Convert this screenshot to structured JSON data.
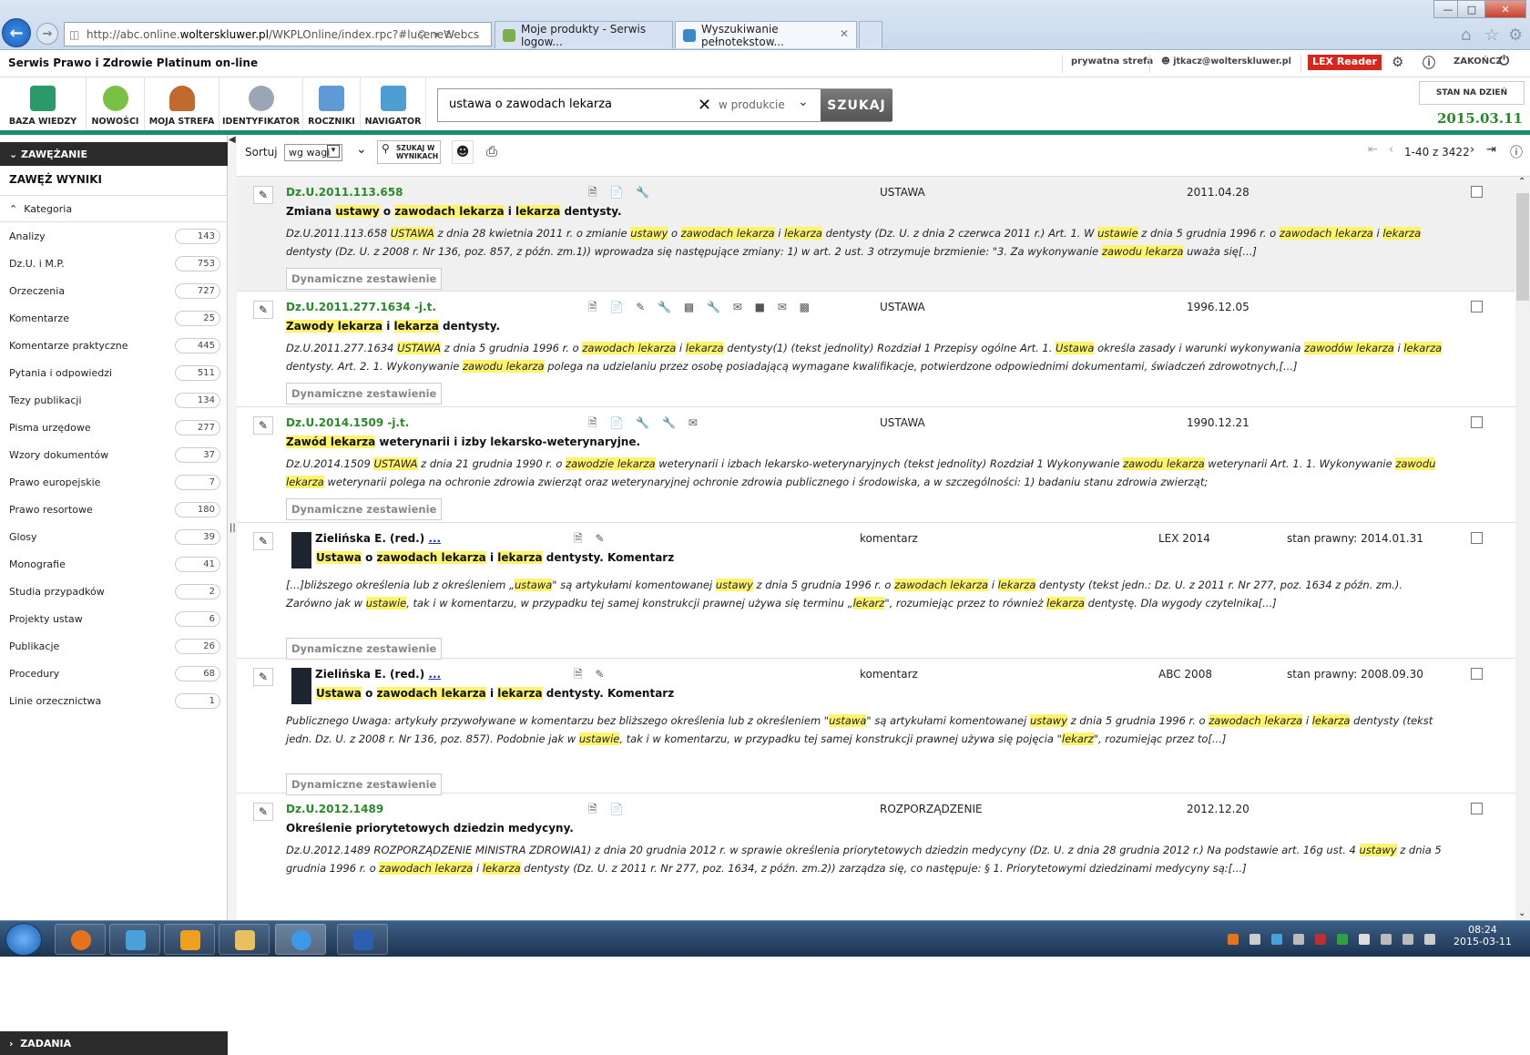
{
  "browser": {
    "url_prefix": "http://abc.online.",
    "url_domain": "wolterskluwer.pl",
    "url_rest": "/WKPLOnline/index.rpc?#luceneWebcs",
    "tabs": [
      {
        "label": "Moje produkty - Serwis logow..."
      },
      {
        "label": "Wyszukiwanie pełnotekstow..."
      }
    ]
  },
  "header": {
    "brand": "Serwis Prawo i Zdrowie Platinum on-line",
    "private": "prywatna strefa",
    "user": "jtkacz@wolterskluwer.pl",
    "lex_reader": "LEX Reader",
    "logout": "ZAKOŃCZ",
    "stan_label": "STAN NA DZIEŃ",
    "date": "2015.03.11"
  },
  "nav": [
    {
      "label": "BAZA WIEDZY",
      "icon": "knowledge-base-icon",
      "color": "#2a9a6a"
    },
    {
      "label": "NOWOŚCI",
      "icon": "news-icon",
      "color": "#7ac043"
    },
    {
      "label": "MOJA STREFA",
      "icon": "user-icon",
      "color": "#c06a30"
    },
    {
      "label": "IDENTYFIKATOR",
      "icon": "magnifier-icon",
      "color": "#9aa6b4"
    },
    {
      "label": "ROCZNIKI",
      "icon": "books-icon",
      "color": "#5f9ad6"
    },
    {
      "label": "NAVIGATOR",
      "icon": "navigator-icon",
      "color": "#4c9fd0"
    }
  ],
  "search": {
    "value": "ustawa o zawodach lekarza",
    "scope": "w produkcie",
    "button": "SZUKAJ"
  },
  "sidebar": {
    "zawezanie": "ZAWĘŻANIE",
    "zawez": "ZAWĘŻ WYNIKI",
    "kategoria": "Kategoria",
    "zadania": "ZADANIA",
    "items": [
      {
        "label": "Analizy",
        "count": "143"
      },
      {
        "label": "Dz.U. i M.P.",
        "count": "753"
      },
      {
        "label": "Orzeczenia",
        "count": "727"
      },
      {
        "label": "Komentarze",
        "count": "25"
      },
      {
        "label": "Komentarze praktyczne",
        "count": "445"
      },
      {
        "label": "Pytania i odpowiedzi",
        "count": "511"
      },
      {
        "label": "Tezy publikacji",
        "count": "134"
      },
      {
        "label": "Pisma urzędowe",
        "count": "277"
      },
      {
        "label": "Wzory dokumentów",
        "count": "37"
      },
      {
        "label": "Prawo europejskie",
        "count": "7"
      },
      {
        "label": "Prawo resortowe",
        "count": "180"
      },
      {
        "label": "Glosy",
        "count": "39"
      },
      {
        "label": "Monografie",
        "count": "41"
      },
      {
        "label": "Studia przypadków",
        "count": "2"
      },
      {
        "label": "Projekty ustaw",
        "count": "6"
      },
      {
        "label": "Publikacje",
        "count": "26"
      },
      {
        "label": "Procedury",
        "count": "68"
      },
      {
        "label": "Linie orzecznictwa",
        "count": "1"
      }
    ]
  },
  "toolbar": {
    "sort": "Sortuj",
    "sort_value": "wg wagi",
    "search_in": "SZUKAJ W WYNIKACH",
    "pager": "1-40 z 3422"
  },
  "dyn_label": "Dynamiczne zestawienie",
  "results": [
    {
      "sig": "Dz.U.2011.113.658",
      "type": "USTAWA",
      "date": "2011.04.28",
      "title": "Zmiana <span class='hl'>ustawy</span> o <span class='hl'>zawodach lekarza</span> i <span class='hl'>lekarza</span> dentysty.",
      "snippet": "Dz.U.2011.113.658 <span class='hl'>USTAWA</span> z dnia 28 kwietnia 2011 r. o zmianie <span class='hl'>ustawy</span> o <span class='hl'>zawodach lekarza</span> i <span class='hl'>lekarza</span> dentysty (Dz. U. z dnia 2 czerwca 2011 r.) Art. 1. W <span class='hl'>ustawie</span> z dnia 5 grudnia 1996 r. o <span class='hl'>zawodach lekarza</span> i <span class='hl'>lekarza</span> dentysty (Dz. U. z 2008 r. Nr 136, poz. 857, z późn. zm.1)) wprowadza się następujące zmiany: 1) w art. 2 ust. 3 otrzymuje brzmienie: \"3. Za wykonywanie <span class='hl'>zawodu lekarza</span> uważa się[...]"
    },
    {
      "sig": "Dz.U.2011.277.1634 -j.t.",
      "type": "USTAWA",
      "date": "1996.12.05",
      "title": "<span class='hl'>Zawody lekarza</span> i <span class='hl'>lekarza</span> dentysty.",
      "snippet": "Dz.U.2011.277.1634 <span class='hl'>USTAWA</span> z dnia 5 grudnia 1996 r. o <span class='hl'>zawodach lekarza</span> i <span class='hl'>lekarza</span> dentysty(1) (tekst jednolity) Rozdział 1 Przepisy ogólne Art. 1. <span class='hl'>Ustawa</span> określa zasady i warunki wykonywania <span class='hl'>zawodów lekarza</span> i <span class='hl'>lekarza</span> dentysty. Art. 2. 1. Wykonywanie <span class='hl'>zawodu lekarza</span> polega na udzielaniu przez osobę posiadającą wymagane kwalifikacje, potwierdzone odpowiednimi dokumentami, świadczeń zdrowotnych,[...]"
    },
    {
      "sig": "Dz.U.2014.1509 -j.t.",
      "type": "USTAWA",
      "date": "1990.12.21",
      "title": "<span class='hl'>Zawód lekarza</span> weterynarii i izby lekarsko-weterynaryjne.",
      "snippet": "Dz.U.2014.1509 <span class='hl'>USTAWA</span> z dnia 21 grudnia 1990 r. o <span class='hl'>zawodzie lekarza</span> weterynarii i izbach lekarsko-weterynaryjnych (tekst jednolity) Rozdział 1 Wykonywanie <span class='hl'>zawodu lekarza</span> weterynarii Art. 1. 1. Wykonywanie <span class='hl'>zawodu lekarza</span> weterynarii polega na ochronie zdrowia zwierząt oraz weterynaryjnej ochronie zdrowia publicznego i środowiska, a w szczególności: 1) badaniu stanu zdrowia zwierząt;"
    },
    {
      "sig": "Zielińska E. (red.)",
      "more": "...",
      "type": "komentarz",
      "source": "LEX 2014",
      "stan": "stan prawny: 2014.01.31",
      "title": "<span class='hl'>Ustawa</span> o <span class='hl'>zawodach lekarza</span> i <span class='hl'>lekarza</span> dentysty. Komentarz",
      "snippet": "[...]bliższego określenia lub z określeniem „<span class='hl'>ustawa</span>\" są artykułami komentowanej <span class='hl'>ustawy</span> z dnia 5 grudnia 1996 r. o <span class='hl'>zawodach lekarza</span> i <span class='hl'>lekarza</span> dentysty (tekst jedn.: Dz. U. z 2011 r. Nr 277, poz. 1634 z późn. zm.). Zarówno jak w <span class='hl'>ustawie</span>, tak i w komentarzu, w przypadku tej samej konstrukcji prawnej używa się terminu „<span class='hl'>lekarz</span>\", rozumiejąc przez to również <span class='hl'>lekarza</span> dentystę. Dla wygody czytelnika[...]"
    },
    {
      "sig": "Zielińska E. (red.)",
      "more": "...",
      "type": "komentarz",
      "source": "ABC 2008",
      "stan": "stan prawny: 2008.09.30",
      "title": "<span class='hl'>Ustawa</span> o <span class='hl'>zawodach lekarza</span> i <span class='hl'>lekarza</span> dentysty. Komentarz",
      "snippet": "Publicznego Uwaga: artykuły przywoływane w komentarzu bez bliższego określenia lub z określeniem \"<span class='hl'>ustawa</span>\" są artykułami komentowanej <span class='hl'>ustawy</span> z dnia 5 grudnia 1996 r. o <span class='hl'>zawodach lekarza</span> i <span class='hl'>lekarza</span> dentysty (tekst jedn. Dz. U. z 2008 r. Nr 136, poz. 857). Podobnie jak w <span class='hl'>ustawie</span>, tak i w komentarzu, w przypadku tej samej konstrukcji prawnej używa się pojęcia \"<span class='hl'>lekarz</span>\", rozumiejąc przez to[...]"
    },
    {
      "sig": "Dz.U.2012.1489",
      "type": "ROZPORZĄDZENIE",
      "date": "2012.12.20",
      "title": "Określenie priorytetowych dziedzin medycyny.",
      "snippet": "Dz.U.2012.1489 ROZPORZĄDZENIE MINISTRA ZDROWIA1) z dnia 20 grudnia 2012 r. w sprawie określenia priorytetowych dziedzin medycyny (Dz. U. z dnia 28 grudnia 2012 r.) Na podstawie art. 16g ust. 4 <span class='hl'>ustawy</span> z dnia 5 grudnia 1996 r. o <span class='hl'>zawodach lekarza</span> i <span class='hl'>lekarza</span> dentysty (Dz. U. z 2011 r. Nr 277, poz. 1634, z późn. zm.2)) zarządza się, co następuje: § 1. Priorytetowymi dziedzinami medycyny są:[...]"
    }
  ],
  "taskbar": {
    "time": "08:24",
    "date": "2015-03-11"
  }
}
